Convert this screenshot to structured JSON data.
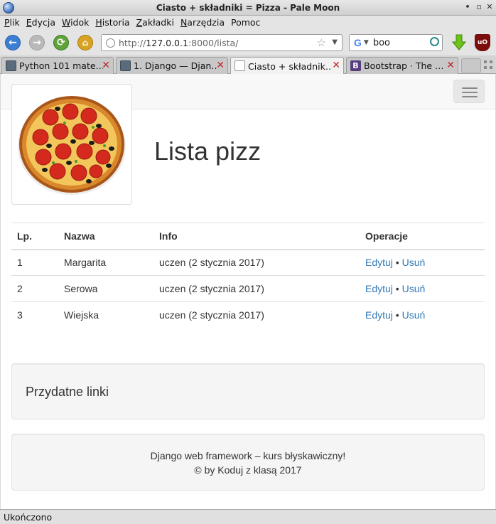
{
  "window": {
    "title": "Ciasto + składniki = Pizza - Pale Moon"
  },
  "menu": [
    {
      "key": "P",
      "rest": "lik"
    },
    {
      "key": "E",
      "rest": "dycja"
    },
    {
      "key": "W",
      "rest": "idok"
    },
    {
      "key": "H",
      "rest": "istoria"
    },
    {
      "key": "Z",
      "rest": "akładki"
    },
    {
      "key": "N",
      "rest": "arzędzia"
    },
    {
      "key": "",
      "rest": "Pomoc"
    }
  ],
  "toolbar": {
    "url_scheme": "http://",
    "url_host": "127.0.0.1",
    "url_path": ":8000/lista/",
    "search_value": "boo",
    "search_engine_letter": "G",
    "ublock_label": "uO"
  },
  "tabs": [
    {
      "label": "Python 101 mate…",
      "icon": "doc-book-icon",
      "active": false
    },
    {
      "label": "1. Django — Djan…",
      "icon": "doc-book-icon",
      "active": false
    },
    {
      "label": "Ciasto + składnik…",
      "icon": "page-icon",
      "active": true
    },
    {
      "label": "Bootstrap · The …",
      "icon": "bootstrap-icon",
      "active": false
    }
  ],
  "tab_close_glyph": "✕",
  "page": {
    "title": "Lista pizz",
    "table": {
      "headers": [
        "Lp.",
        "Nazwa",
        "Info",
        "Operacje"
      ],
      "rows": [
        {
          "lp": "1",
          "name": "Margarita",
          "info": "uczen (2 stycznia 2017)",
          "edit": "Edytuj",
          "sep": " • ",
          "delete": "Usuń"
        },
        {
          "lp": "2",
          "name": "Serowa",
          "info": "uczen (2 stycznia 2017)",
          "edit": "Edytuj",
          "sep": " • ",
          "delete": "Usuń"
        },
        {
          "lp": "3",
          "name": "Wiejska",
          "info": "uczen (2 stycznia 2017)",
          "edit": "Edytuj",
          "sep": " • ",
          "delete": "Usuń"
        }
      ]
    },
    "links_heading": "Przydatne linki",
    "footer_line1": "Django web framework – kurs błyskawiczny!",
    "footer_line2": "© by Koduj z klasą 2017"
  },
  "status": "Ukończono",
  "colors": {
    "link": "#337ab7",
    "tab_close": "#c0262b",
    "ublock": "#7b0d0d"
  }
}
